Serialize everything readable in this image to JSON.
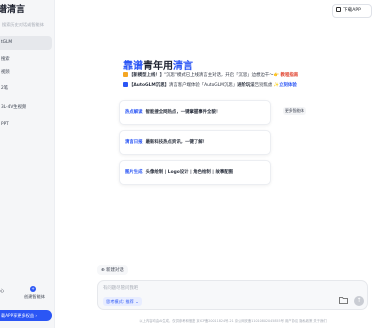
{
  "sidebar": {
    "logo": "谱清言",
    "search_placeholder": "搜索历史对话或智能体",
    "items": [
      {
        "label": "tGLM",
        "active": true
      },
      {
        "label": "搜索"
      },
      {
        "label": "视频"
      },
      {
        "label": "2笔"
      },
      {
        "label": "3L-4V生视频"
      },
      {
        "label": "PPT"
      }
    ],
    "bottom": {
      "left_label": "心",
      "create_label": "创建智能体",
      "download_label": "载APP享更多权益 ›"
    }
  },
  "header": {
    "download_button": "下载APP"
  },
  "main": {
    "hero": {
      "part1": "靠谱",
      "part2": "青年用",
      "part3": "清言"
    },
    "notices": [
      {
        "bold": "【新模型上线！】",
        "text": "\"沉思\"模式已上线清言主对话，开启「沉思」边想边干～",
        "link": "👉 教程指南"
      },
      {
        "bold": "【AutoGLM沉思】",
        "text": "清言客户端体验「AutoGLM沉思」",
        "text2": "进阶玩法",
        "text3": "告别焦虑 ✨",
        "link": "立刻体验"
      }
    ],
    "cards": [
      {
        "tag": "热点解读",
        "text": "智能搜全网热点，一键掌握事件全貌！"
      },
      {
        "tag": "清言日报",
        "text": "最新科技热点资讯，一键了解！"
      },
      {
        "tag": "图片生成",
        "text": "头像绘制 | Logo设计 | 角色绘制 | 故事配图"
      }
    ],
    "more_label": "更多智能体"
  },
  "composer": {
    "new_chat": "新建对话",
    "placeholder": "有问题尽管问我吧",
    "mode_label": "思考模式: 推荐 ⌄",
    "send_icon": "↑"
  },
  "footer": {
    "text": "以上内容均由AI生成，仅供参考和借鉴    京ICP备20011824号-21    京公网安备11010802045855号    用户协议    隐私政策    关于我们"
  },
  "colors": {
    "accent": "#2b56f5",
    "warning": "#e0402c"
  }
}
